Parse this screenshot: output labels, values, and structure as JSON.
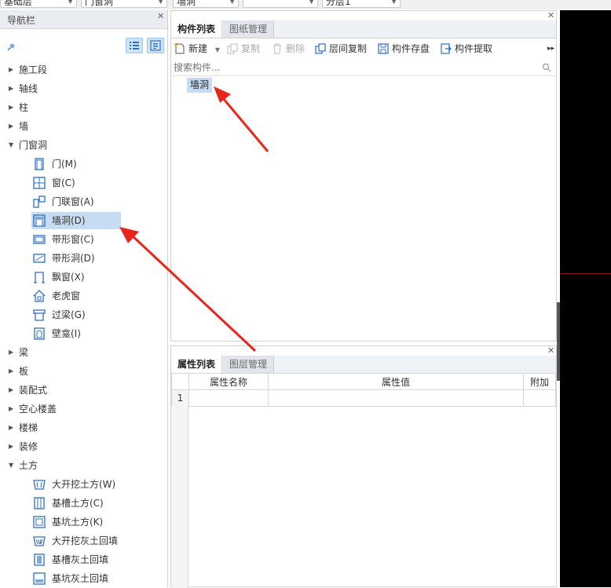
{
  "topbar": {
    "selects": [
      "基础层",
      "门窗洞",
      "墙洞",
      "",
      "分层1"
    ]
  },
  "nav": {
    "title": "导航栏",
    "tree": [
      {
        "label": "施工段",
        "expanded": false
      },
      {
        "label": "轴线",
        "expanded": false
      },
      {
        "label": "柱",
        "expanded": false
      },
      {
        "label": "墙",
        "expanded": false
      },
      {
        "label": "门窗洞",
        "expanded": true,
        "children": [
          {
            "label": "门(M)",
            "icon": "door-icon"
          },
          {
            "label": "窗(C)",
            "icon": "window-icon"
          },
          {
            "label": "门联窗(A)",
            "icon": "door-window-icon"
          },
          {
            "label": "墙洞(D)",
            "icon": "wall-opening-icon",
            "selected": true
          },
          {
            "label": "带形窗(C)",
            "icon": "strip-window-icon"
          },
          {
            "label": "带形洞(D)",
            "icon": "strip-opening-icon"
          },
          {
            "label": "飘窗(X)",
            "icon": "bay-window-icon"
          },
          {
            "label": "老虎窗",
            "icon": "dormer-window-icon"
          },
          {
            "label": "过梁(G)",
            "icon": "lintel-icon"
          },
          {
            "label": "壁龛(I)",
            "icon": "niche-icon"
          }
        ]
      },
      {
        "label": "梁",
        "expanded": false
      },
      {
        "label": "板",
        "expanded": false
      },
      {
        "label": "装配式",
        "expanded": false
      },
      {
        "label": "空心楼盖",
        "expanded": false
      },
      {
        "label": "楼梯",
        "expanded": false
      },
      {
        "label": "装修",
        "expanded": false
      },
      {
        "label": "土方",
        "expanded": true,
        "children": [
          {
            "label": "大开挖土方(W)",
            "icon": "excavation-icon"
          },
          {
            "label": "基槽土方(C)",
            "icon": "trench-icon"
          },
          {
            "label": "基坑土方(K)",
            "icon": "pit-icon"
          },
          {
            "label": "大开挖灰土回填",
            "icon": "excavation-backfill-icon"
          },
          {
            "label": "基槽灰土回填",
            "icon": "trench-backfill-icon"
          },
          {
            "label": "基坑灰土回填",
            "icon": "pit-backfill-icon"
          }
        ]
      }
    ]
  },
  "component_panel": {
    "tabs": [
      "构件列表",
      "图纸管理"
    ],
    "toolbar": {
      "new": "新建",
      "copy": "复制",
      "delete": "删除",
      "floor_copy": "层间复制",
      "save": "构件存盘",
      "extract": "构件提取"
    },
    "search_placeholder": "搜索构件...",
    "items": [
      "墙洞"
    ]
  },
  "property_panel": {
    "tabs": [
      "属性列表",
      "图层管理"
    ],
    "columns": [
      "属性名称",
      "属性值",
      "附加"
    ],
    "rows": [
      {
        "index": "1",
        "name": "",
        "value": "",
        "extra": ""
      }
    ]
  },
  "colors": {
    "selection": "#c5dcf3",
    "annotation_arrow": "#e8261c",
    "canvas": "#000000"
  }
}
